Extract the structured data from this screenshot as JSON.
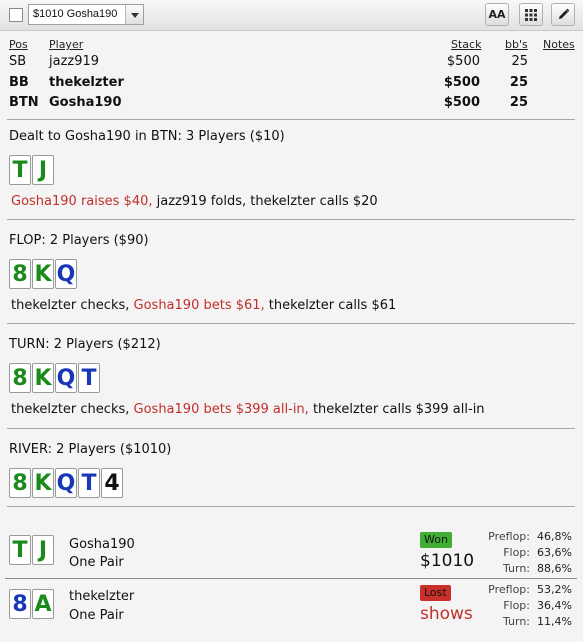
{
  "toolbar": {
    "selected_hand": "$1010 Gosha190",
    "font_button": "AA"
  },
  "headers": {
    "pos": "Pos",
    "player": "Player",
    "stack": "Stack",
    "bbs": "bb's",
    "notes": "Notes"
  },
  "players": [
    {
      "pos": "SB",
      "name": "jazz919",
      "stack": "$500",
      "bbs": "25",
      "bold": false
    },
    {
      "pos": "BB",
      "name": "thekelzter",
      "stack": "$500",
      "bbs": "25",
      "bold": true
    },
    {
      "pos": "BTN",
      "name": "Gosha190",
      "stack": "$500",
      "bbs": "25",
      "bold": true
    }
  ],
  "preflop": {
    "title": "Dealt to Gosha190 in BTN: 3 Players ($10)",
    "cards": [
      "T",
      "J"
    ],
    "hero_action": "Gosha190 raises $40,",
    "rest": " jazz919 folds, thekelzter calls $20"
  },
  "flop": {
    "title": "FLOP: 2 Players ($90)",
    "cards": [
      "8",
      "K",
      "Q"
    ],
    "pre": "thekelzter checks, ",
    "hero_action": "Gosha190 bets $61,",
    "post": " thekelzter calls $61"
  },
  "turn": {
    "title": "TURN: 2 Players ($212)",
    "cards": [
      "8",
      "K",
      "Q",
      "T"
    ],
    "pre": "thekelzter checks, ",
    "hero_action": "Gosha190 bets $399 all-in,",
    "post": " thekelzter calls $399 all-in"
  },
  "river": {
    "title": "RIVER: 2 Players ($1010)",
    "cards": [
      "8",
      "K",
      "Q",
      "T",
      "4"
    ]
  },
  "results": [
    {
      "cards": [
        "T",
        "J"
      ],
      "name": "Gosha190",
      "hand": "One Pair",
      "badge": "Won",
      "amount": "$1010",
      "stats": [
        {
          "label": "Preflop:",
          "value": "46,8%"
        },
        {
          "label": "Flop:",
          "value": "63,6%"
        },
        {
          "label": "Turn:",
          "value": "88,6%"
        }
      ]
    },
    {
      "cards": [
        "8",
        "A"
      ],
      "name": "thekelzter",
      "hand": "One Pair",
      "badge": "Lost",
      "amount": "shows",
      "stats": [
        {
          "label": "Preflop:",
          "value": "53,2%"
        },
        {
          "label": "Flop:",
          "value": "36,4%"
        },
        {
          "label": "Turn:",
          "value": "11,4%"
        }
      ]
    }
  ],
  "colors": {
    "hero_action": "#c0302b",
    "won": "#3fae32",
    "lost": "#c9302b",
    "club": "#1a8a1a",
    "diamond": "#1838b8",
    "spade": "#111111"
  }
}
